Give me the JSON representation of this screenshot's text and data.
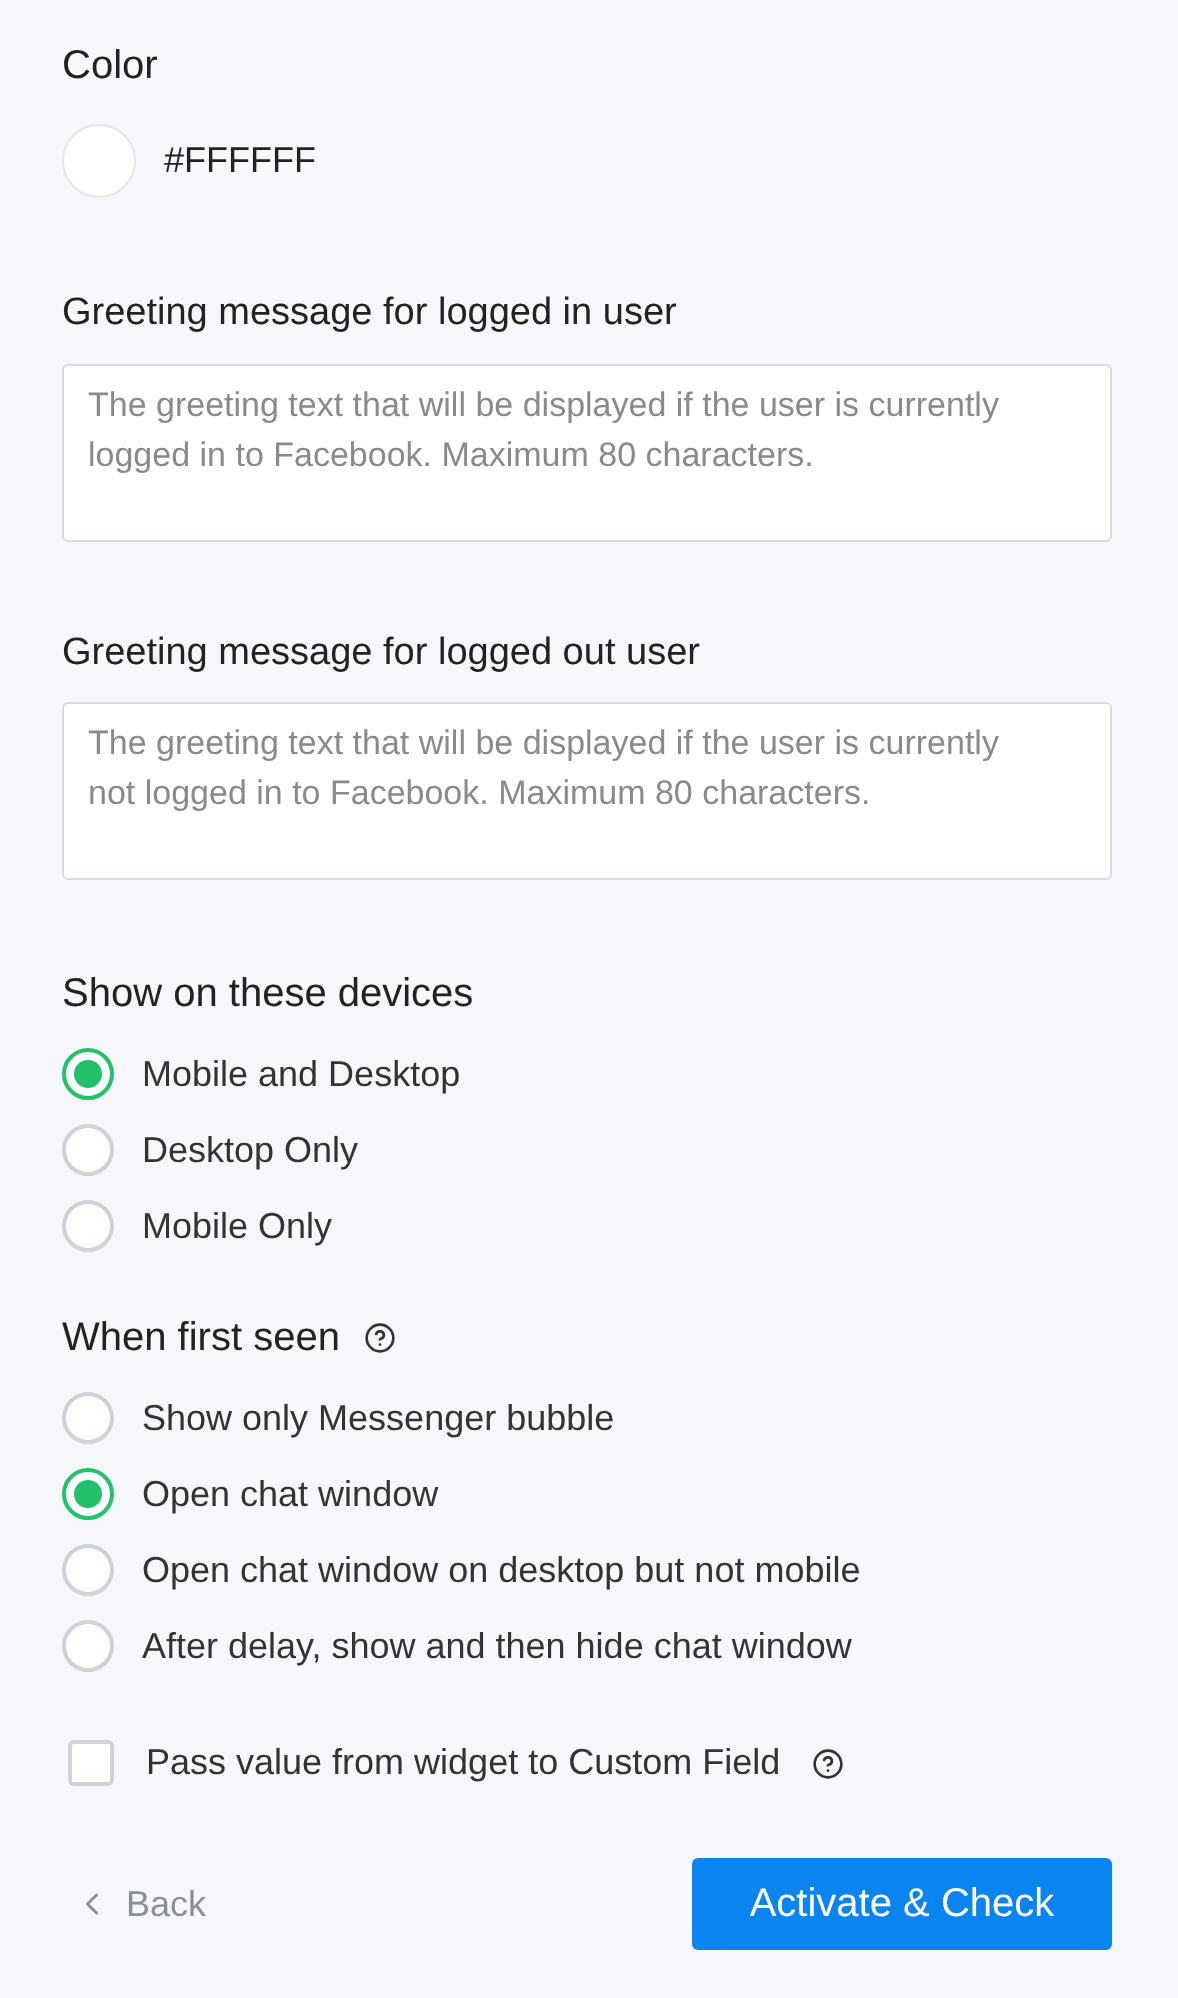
{
  "color": {
    "label": "Color",
    "value": "#FFFFFF"
  },
  "greeting_logged_in": {
    "label": "Greeting message for logged in user",
    "placeholder": "The greeting text that will be displayed if the user is currently logged in to Facebook. Maximum 80 characters."
  },
  "greeting_logged_out": {
    "label": "Greeting message for logged out user",
    "placeholder": "The greeting text that will be displayed if the user is currently not logged in to Facebook. Maximum 80 characters."
  },
  "devices": {
    "label": "Show on these devices",
    "options": [
      {
        "label": "Mobile and Desktop",
        "selected": true
      },
      {
        "label": "Desktop Only",
        "selected": false
      },
      {
        "label": "Mobile Only",
        "selected": false
      }
    ]
  },
  "first_seen": {
    "label": "When first seen",
    "help": true,
    "options": [
      {
        "label": "Show only Messenger bubble",
        "selected": false
      },
      {
        "label": "Open chat window",
        "selected": true
      },
      {
        "label": "Open chat window on desktop but not mobile",
        "selected": false
      },
      {
        "label": "After delay, show and then hide chat window",
        "selected": false
      }
    ]
  },
  "pass_value": {
    "label": "Pass value from widget to Custom Field",
    "checked": false,
    "help": true
  },
  "back": "Back",
  "submit": "Activate & Check"
}
